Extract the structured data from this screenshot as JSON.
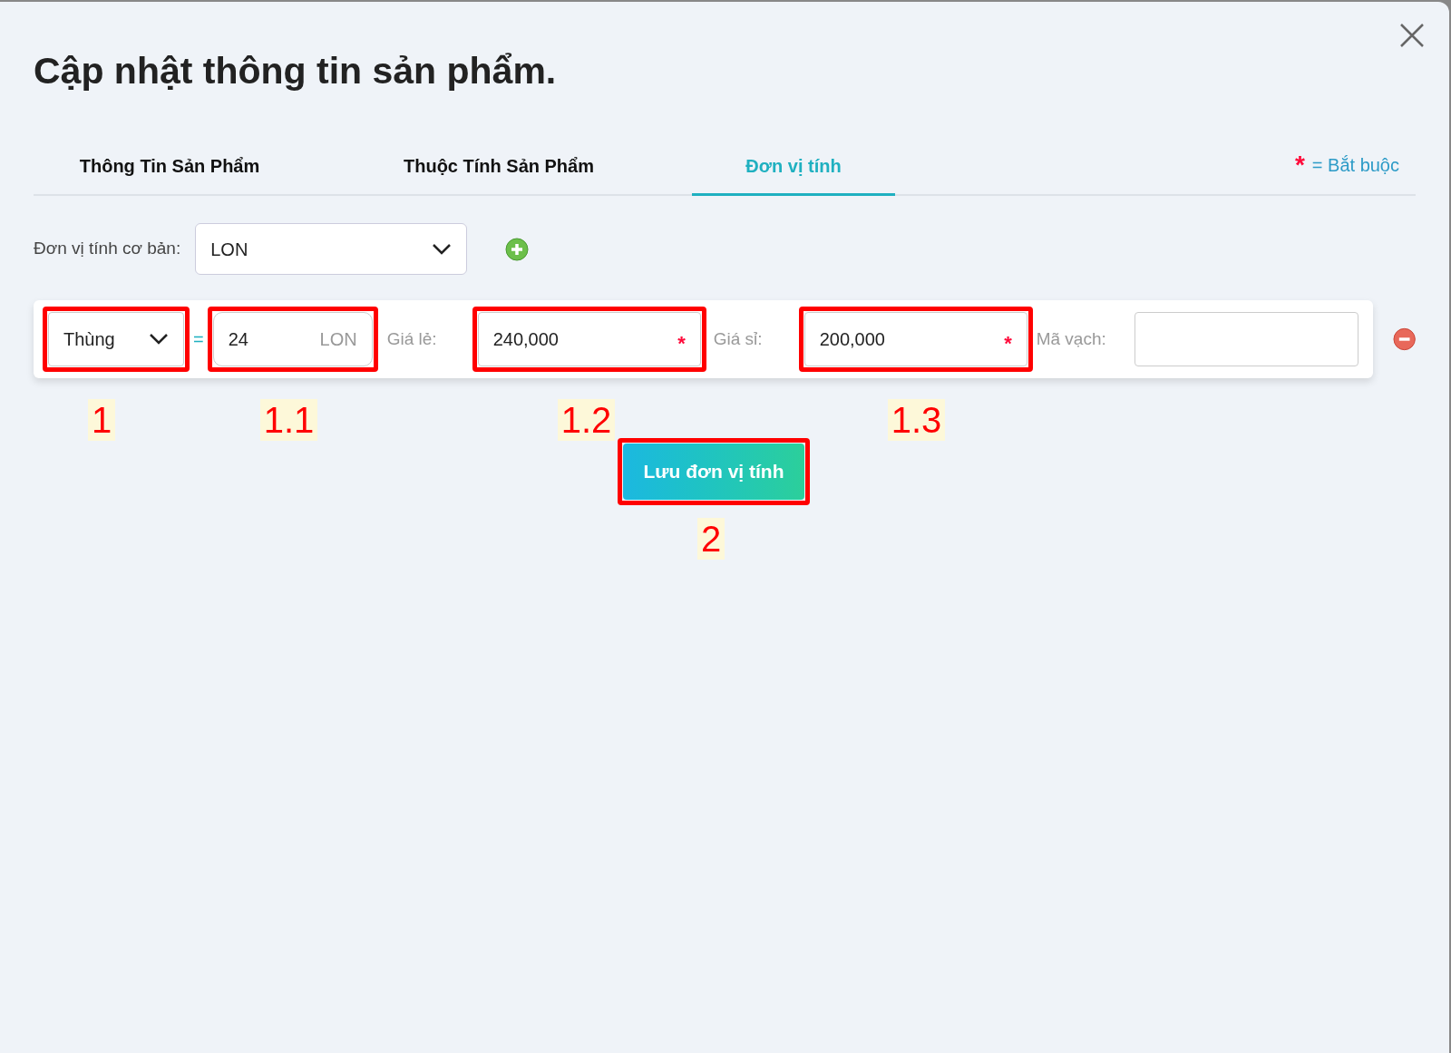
{
  "dialog": {
    "title": "Cập nhật thông tin sản phẩm."
  },
  "tabs": [
    {
      "label": "Thông Tin Sản Phẩm",
      "selected": false
    },
    {
      "label": "Thuộc Tính Sản Phẩm",
      "selected": false
    },
    {
      "label": "Đơn vị tính",
      "selected": true
    }
  ],
  "required_note": {
    "mark": "*",
    "text": "= Bắt buộc"
  },
  "base_unit": {
    "label": "Đơn vị tính cơ bản:",
    "value": "LON"
  },
  "unit_row": {
    "unit": "Thùng",
    "equals": "=",
    "quantity": "24",
    "quantity_unit": "LON",
    "retail_label": "Giá lẻ:",
    "retail_price": "240,000",
    "retail_mark": "*",
    "wholesale_label": "Giá sỉ:",
    "wholesale_price": "200,000",
    "wholesale_mark": "*",
    "barcode_label": "Mã vạch:"
  },
  "save_button": "Lưu đơn vị tính",
  "annotations": [
    "1",
    "1.1",
    "1.2",
    "1.3",
    "2"
  ]
}
